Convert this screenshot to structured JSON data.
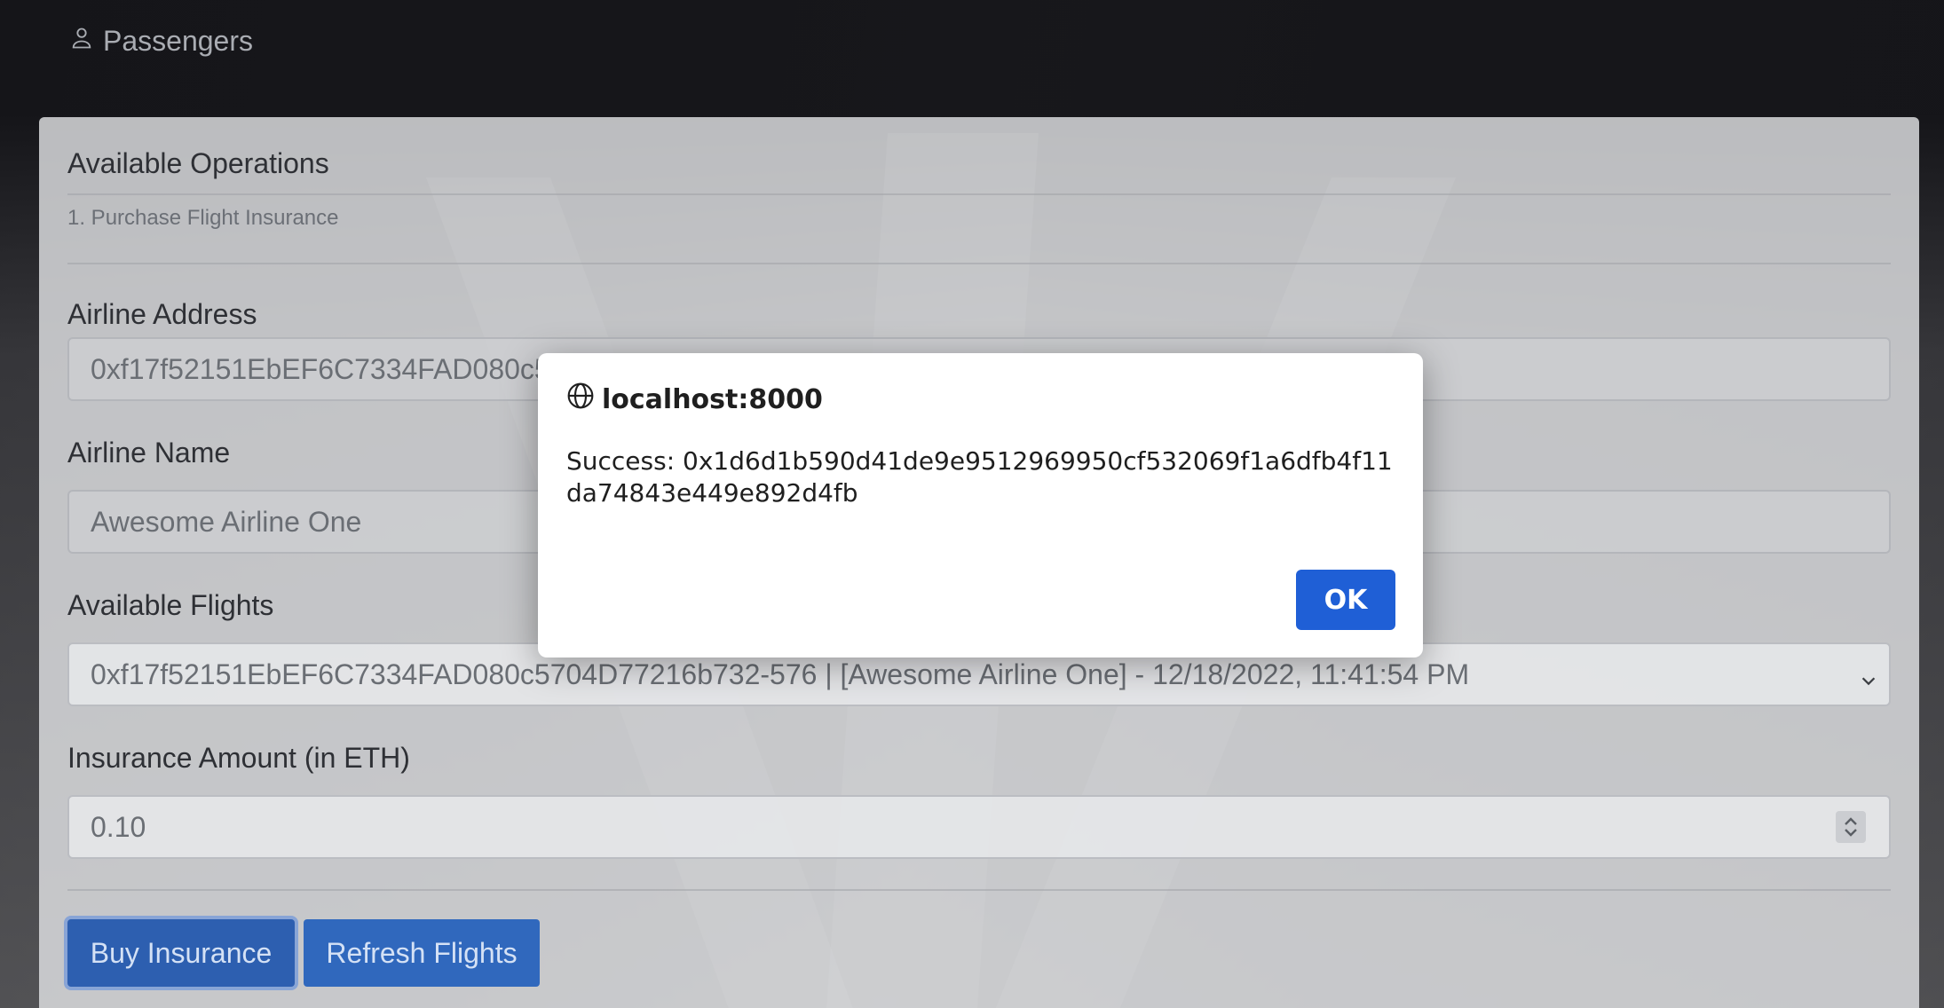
{
  "nav": {
    "passengers_label": "Passengers",
    "icon": "person-icon"
  },
  "card": {
    "title": "Available Operations",
    "operations": [
      "1. Purchase Flight Insurance"
    ]
  },
  "form": {
    "airline_address": {
      "label": "Airline Address",
      "value": "0xf17f52151EbEF6C7334FAD080c5704D77216b732"
    },
    "airline_name": {
      "label": "Airline Name",
      "value": "Awesome Airline One"
    },
    "available_flights": {
      "label": "Available Flights",
      "selected": "0xf17f52151EbEF6C7334FAD080c5704D77216b732-576 | [Awesome Airline One] - 12/18/2022, 11:41:54 PM"
    },
    "insurance_amount": {
      "label": "Insurance Amount (in ETH)",
      "value": "0.10"
    }
  },
  "buttons": {
    "buy_insurance": "Buy Insurance",
    "refresh_flights": "Refresh Flights"
  },
  "dialog": {
    "origin": "localhost:8000",
    "message": "Success: 0x1d6d1b590d41de9e9512969950cf532069f1a6dfb4f11da74843e449e892d4fb",
    "ok_label": "OK"
  },
  "colors": {
    "primary_button": "#3068bd",
    "dialog_ok": "#1f5fd6"
  }
}
